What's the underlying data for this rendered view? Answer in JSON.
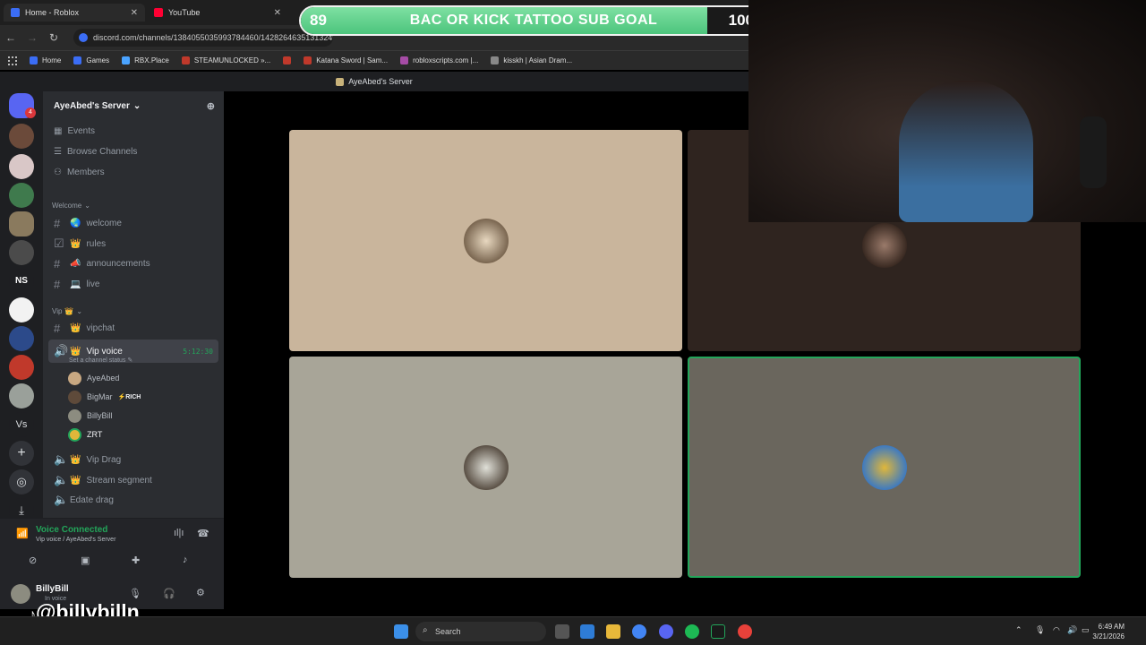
{
  "browser": {
    "tabs": [
      {
        "title": "Home - Roblox",
        "color": "#3b6df5"
      },
      {
        "title": "YouTube",
        "color": "#ff0033"
      }
    ],
    "url": "discord.com/channels/1384055035993784460/1428264635131324915",
    "bookmarks": [
      {
        "label": "Home",
        "color": "#3b6df5"
      },
      {
        "label": "Games",
        "color": "#3b6df5"
      },
      {
        "label": "RBX.Place",
        "color": "#4aa3ff"
      },
      {
        "label": "STEAMUNLOCKED »...",
        "color": "#c0392b"
      },
      {
        "label": "",
        "color": "#c0392b"
      },
      {
        "label": "Katana Sword | Sam...",
        "color": "#c0392b"
      },
      {
        "label": "robloxscripts.com |...",
        "color": "#a64ca6"
      },
      {
        "label": "kisskh | Asian Dram...",
        "color": "#888888"
      }
    ]
  },
  "goal": {
    "start": "89",
    "title": "BAC OR KICK TATTOO SUB GOAL",
    "end": "100",
    "progress": 0.88
  },
  "discord": {
    "window_title": "AyeAbed's Server",
    "rail_badge": "4",
    "server_name": "AyeAbed's Server",
    "top_links": [
      "Events",
      "Browse Channels",
      "Members"
    ],
    "categories": {
      "welcome": "Welcome",
      "vip": "Vip"
    },
    "welcome_channels": [
      "welcome",
      "rules",
      "announcements",
      "live"
    ],
    "vip_text": "vipchat",
    "active_voice": {
      "name": "Vip voice",
      "time": "5:12:30",
      "status": "Set a channel status"
    },
    "voice_users": [
      {
        "name": "AyeAbed",
        "tag": ""
      },
      {
        "name": "BigMar",
        "tag": "⚡RICH"
      },
      {
        "name": "BillyBill",
        "tag": ""
      },
      {
        "name": "ZRT",
        "tag": ""
      }
    ],
    "more_voice": [
      "Vip Drag",
      "Stream segment",
      "Edate drag"
    ],
    "voice_connected": {
      "title": "Voice Connected",
      "subtitle": "Vip voice / AyeAbed's Server"
    },
    "user": {
      "name": "BillyBill",
      "status": "In voice"
    },
    "rail_label": "Vs",
    "ns_label": "NS"
  },
  "watermark": "@billybilln",
  "taskbar": {
    "search": "Search",
    "time": "6:49 AM",
    "date": "3/21/2026"
  },
  "colors": {
    "accent_green": "#23a55a",
    "goal_green": "#5fd38f"
  }
}
